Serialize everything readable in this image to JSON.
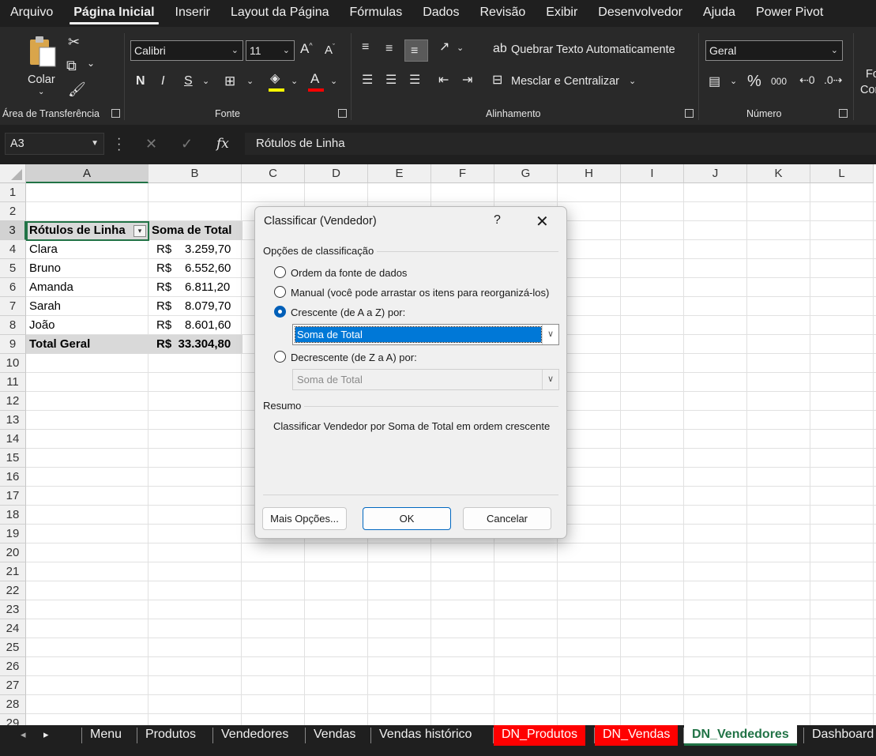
{
  "menu": {
    "tabs": [
      "Arquivo",
      "Página Inicial",
      "Inserir",
      "Layout da Página",
      "Fórmulas",
      "Dados",
      "Revisão",
      "Exibir",
      "Desenvolvedor",
      "Ajuda",
      "Power Pivot"
    ],
    "active": "Página Inicial"
  },
  "ribbon": {
    "clipboard": {
      "paste_label": "Colar",
      "group_label": "Área de Transferência"
    },
    "font": {
      "font_name": "Calibri",
      "font_size": "11",
      "bold": "N",
      "italic": "I",
      "underline": "S",
      "group_label": "Fonte"
    },
    "alignment": {
      "wrap_text": "Quebrar Texto Automaticamente",
      "merge_center": "Mesclar e Centralizar",
      "group_label": "Alinhamento"
    },
    "number": {
      "format": "Geral",
      "percent": "%",
      "thousands": "000",
      "group_label": "Número"
    },
    "cut_off": {
      "line1": "Fo",
      "line2": "Cor"
    }
  },
  "formula_bar": {
    "name_box": "A3",
    "fx": "fx",
    "formula": "Rótulos de Linha"
  },
  "sheet": {
    "columns": [
      "A",
      "B",
      "C",
      "D",
      "E",
      "F",
      "G",
      "H",
      "I",
      "J",
      "K",
      "L"
    ],
    "rows": [
      "1",
      "2",
      "3",
      "4",
      "5",
      "6",
      "7",
      "8",
      "9",
      "10",
      "11",
      "12",
      "13",
      "14",
      "15",
      "16",
      "17",
      "18",
      "19",
      "20",
      "21",
      "22",
      "23",
      "24",
      "25",
      "26",
      "27",
      "28",
      "29"
    ],
    "selected_column": "A",
    "selected_row": "3",
    "pivot": {
      "header_a": "Rótulos de Linha",
      "header_b": "Soma de Total",
      "currency": "R$",
      "rows": [
        {
          "name": "Clara",
          "value": "3.259,70"
        },
        {
          "name": "Bruno",
          "value": "6.552,60"
        },
        {
          "name": "Amanda",
          "value": "6.811,20"
        },
        {
          "name": "Sarah",
          "value": "8.079,70"
        },
        {
          "name": "João",
          "value": "8.601,60"
        }
      ],
      "total_label": "Total Geral",
      "total_value": "R$  33.304,80"
    }
  },
  "dialog": {
    "title": "Classificar (Vendedor)",
    "help": "?",
    "close": "✕",
    "options_label": "Opções de classificação",
    "options": [
      {
        "label": "Ordem da fonte de dados",
        "selected": false
      },
      {
        "label": "Manual (você pode arrastar os itens para reorganizá-los)",
        "selected": false
      },
      {
        "label": "Crescente (de A a Z) por:",
        "selected": true
      },
      {
        "label": "Decrescente (de Z a A) por:",
        "selected": false
      }
    ],
    "ascending_field": "Soma de Total",
    "descending_field": "Soma de Total",
    "summary_label": "Resumo",
    "summary_text": "Classificar Vendedor por Soma de Total em ordem crescente",
    "buttons": {
      "more": "Mais Opções...",
      "ok": "OK",
      "cancel": "Cancelar"
    }
  },
  "sheet_tabs": [
    {
      "label": "Menu",
      "style": "normal"
    },
    {
      "label": "Produtos",
      "style": "normal"
    },
    {
      "label": "Vendedores",
      "style": "normal"
    },
    {
      "label": "Vendas",
      "style": "normal"
    },
    {
      "label": "Vendas histórico",
      "style": "normal"
    },
    {
      "label": "DN_Produtos",
      "style": "red"
    },
    {
      "label": "DN_Vendas",
      "style": "red"
    },
    {
      "label": "DN_Vendedores",
      "style": "active"
    },
    {
      "label": "Dashboard",
      "style": "normal"
    }
  ],
  "colors": {
    "accent": "#217346",
    "dialog_select": "#0078d7",
    "tab_red": "#ff0000"
  }
}
